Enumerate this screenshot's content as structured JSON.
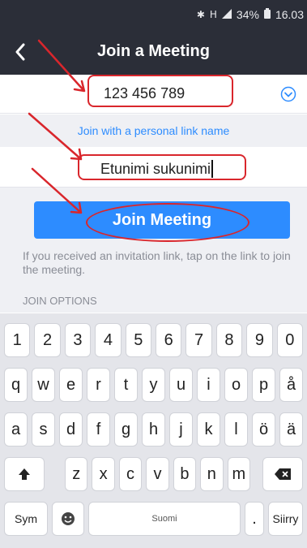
{
  "status_bar": {
    "bluetooth_icon": "bluetooth-icon",
    "network": "H",
    "signal_icon": "signal-icon",
    "battery": "34%",
    "time": "16.03"
  },
  "nav": {
    "title": "Join a Meeting",
    "back_icon": "chevron-left-icon"
  },
  "form": {
    "meeting_id": "123 456 789",
    "dropdown_icon": "chevron-down-circle-icon",
    "personal_link_label": "Join with a personal link name",
    "name_value": "Etunimi sukunimi",
    "join_button": "Join Meeting",
    "info_text": "If you received an invitation link, tap on the link to join the meeting.",
    "join_options_header": "JOIN OPTIONS"
  },
  "keyboard": {
    "row1": [
      "1",
      "2",
      "3",
      "4",
      "5",
      "6",
      "7",
      "8",
      "9",
      "0"
    ],
    "row2": [
      "q",
      "w",
      "e",
      "r",
      "t",
      "y",
      "u",
      "i",
      "o",
      "p",
      "å"
    ],
    "row3": [
      "a",
      "s",
      "d",
      "f",
      "g",
      "h",
      "j",
      "k",
      "l",
      "ö",
      "ä"
    ],
    "row4": [
      "z",
      "x",
      "c",
      "v",
      "b",
      "n",
      "m"
    ],
    "shift_icon": "shift-icon",
    "backspace_icon": "backspace-icon",
    "sym_label": "Sym",
    "emoji_icon": "emoji-icon",
    "space_label": "Suomi",
    "period_label": ".",
    "enter_label": "Siirry"
  },
  "colors": {
    "nav": "#2b2e38",
    "accent": "#2d8cff",
    "annotation": "#d9262c",
    "background_gray": "#eff0f4"
  }
}
